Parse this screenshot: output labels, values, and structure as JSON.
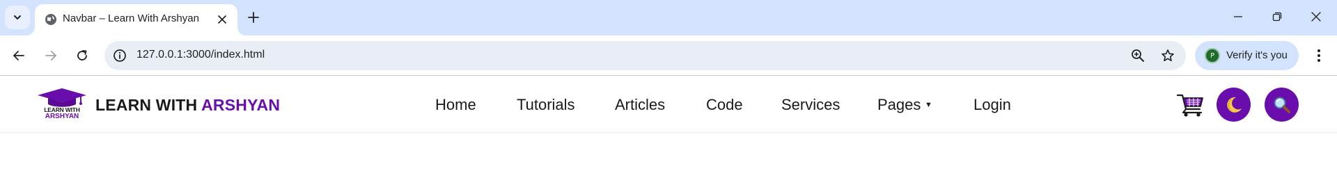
{
  "browser": {
    "tab": {
      "title": "Navbar – Learn With Arshyan"
    },
    "address_bar": {
      "url": "127.0.0.1:3000/index.html"
    },
    "profile": {
      "initial": "P",
      "label": "Verify it's you"
    },
    "icons": {
      "tab_search": "chevron-down-icon",
      "favicon": "globe-icon",
      "tab_close": "close-icon",
      "new_tab": "plus-icon",
      "minimize": "minimize-icon",
      "restore": "restore-icon",
      "close_window": "close-icon",
      "back": "arrow-left-icon",
      "forward": "arrow-right-icon",
      "reload": "reload-icon",
      "site_info": "info-icon",
      "zoom": "zoom-icon",
      "bookmark": "star-icon",
      "menu": "kebab-menu-icon"
    }
  },
  "site": {
    "logo": {
      "line1": "LEARN WITH",
      "line2": "ARSHYAN"
    },
    "brand": {
      "part1": "LEARN WITH ",
      "part2": "ARSHYAN"
    },
    "nav": [
      {
        "label": "Home"
      },
      {
        "label": "Tutorials"
      },
      {
        "label": "Articles"
      },
      {
        "label": "Code"
      },
      {
        "label": "Services"
      },
      {
        "label": "Pages",
        "has_dropdown": true,
        "dropdown_indicator": "▼"
      },
      {
        "label": "Login"
      }
    ],
    "actions": {
      "cart_icon": "shopping-cart-icon",
      "theme_icon": "moon-icon",
      "search_icon": "search-icon"
    },
    "colors": {
      "accent": "#6a0dad",
      "text": "#1a1a1a",
      "tabstrip": "#d3e3fd",
      "omnibox": "#e9eef6"
    }
  }
}
